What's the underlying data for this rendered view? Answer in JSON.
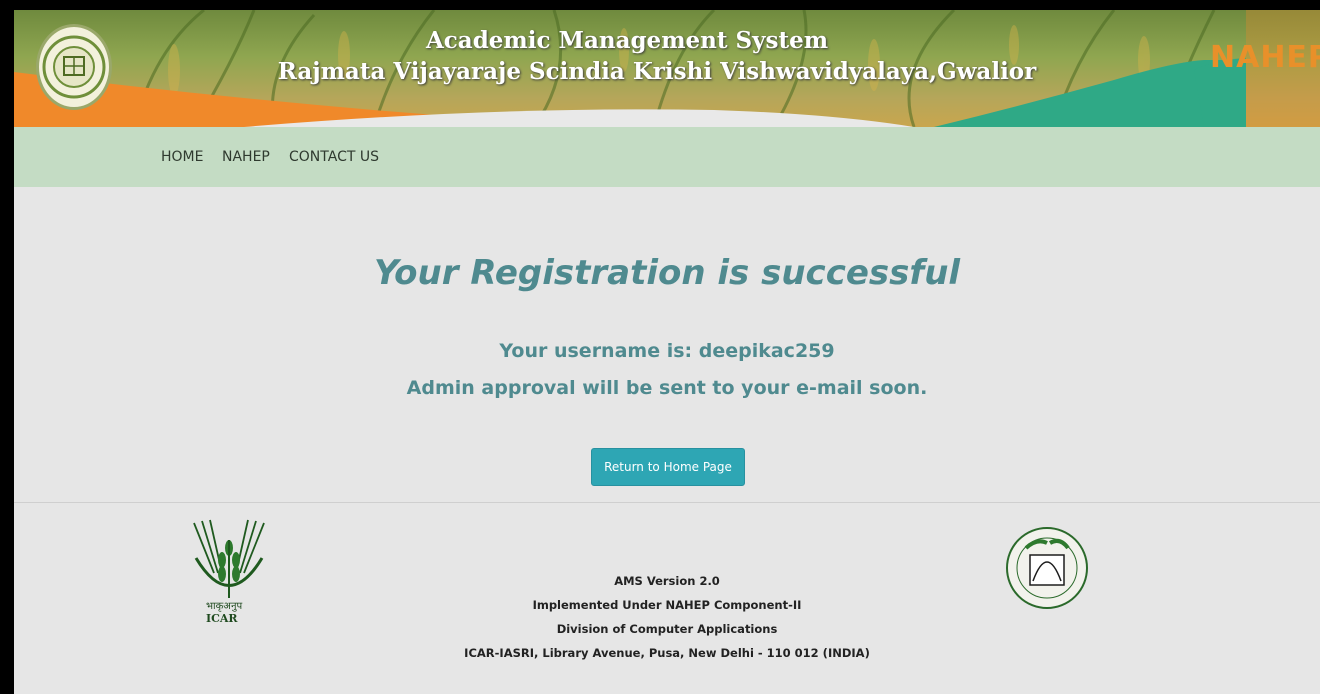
{
  "header": {
    "title_line1": "Academic Management System",
    "title_line2": "Rajmata Vijayaraje Scindia Krishi Vishwavidyalaya,Gwalior",
    "partner_logo_text": "NAHEP"
  },
  "nav": {
    "items": [
      {
        "label": "HOME"
      },
      {
        "label": "NAHEP"
      },
      {
        "label": "CONTACT US"
      }
    ]
  },
  "main": {
    "heading": "Your Registration is successful",
    "username_line": "Your username is: deepikac259",
    "approval_line": "Admin approval will be sent to your e-mail soon.",
    "return_button": "Return to Home Page"
  },
  "footer": {
    "icar_logo_text_hindi": "भाकृअनुप",
    "icar_logo_text": "ICAR",
    "lines": [
      "AMS Version 2.0",
      "Implemented Under NAHEP Component-II",
      "Division of Computer Applications",
      "ICAR-IASRI, Library Avenue, Pusa, New Delhi - 110 012 (INDIA)"
    ]
  },
  "colors": {
    "accent": "#2ea6b4",
    "heading_text": "#4f8a8f",
    "nav_bg": "#c4dcc4",
    "page_bg": "#e6e6e6",
    "banner_orange": "#f0892a",
    "banner_teal": "#2fa986"
  }
}
